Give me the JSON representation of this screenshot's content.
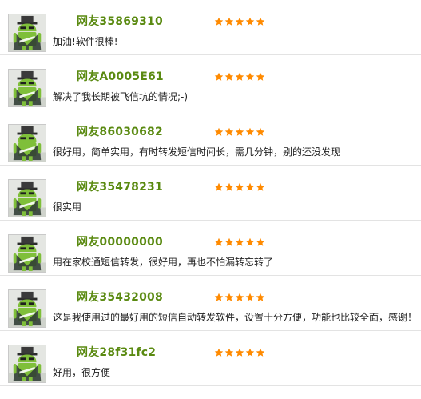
{
  "reviews": [
    {
      "user": "网友35869310",
      "rating": 5,
      "comment": "加油!软件很棒!",
      "marker": ""
    },
    {
      "user": "网友A0005E61",
      "rating": 5,
      "comment": "解决了我长期被飞信坑的情况;-)",
      "marker": ""
    },
    {
      "user": "网友86030682",
      "rating": 5,
      "comment": "很好用，简单实用，有时转发短信时间长，需几分钟，别的还没发现",
      "marker": ""
    },
    {
      "user": "网友35478231",
      "rating": 5,
      "comment": "很实用",
      "marker": ""
    },
    {
      "user": "网友00000000",
      "rating": 5,
      "comment": "用在家校通短信转发，很好用，再也不怕漏转忘转了",
      "marker": ""
    },
    {
      "user": "网友35432008",
      "rating": 5,
      "comment": "这是我使用过的最好用的短信自动转发软件，设置十分方便，功能也比较全面，感谢！",
      "marker": ""
    },
    {
      "user": "网友28f31fc2",
      "rating": 5,
      "comment": "好用，很方便",
      "marker": ""
    }
  ],
  "colors": {
    "username": "#5a8a11",
    "star": "#ff8a00",
    "divider": "#e3e3e3"
  },
  "icons": {
    "avatar": "android-avatar-icon",
    "star": "star-icon"
  }
}
